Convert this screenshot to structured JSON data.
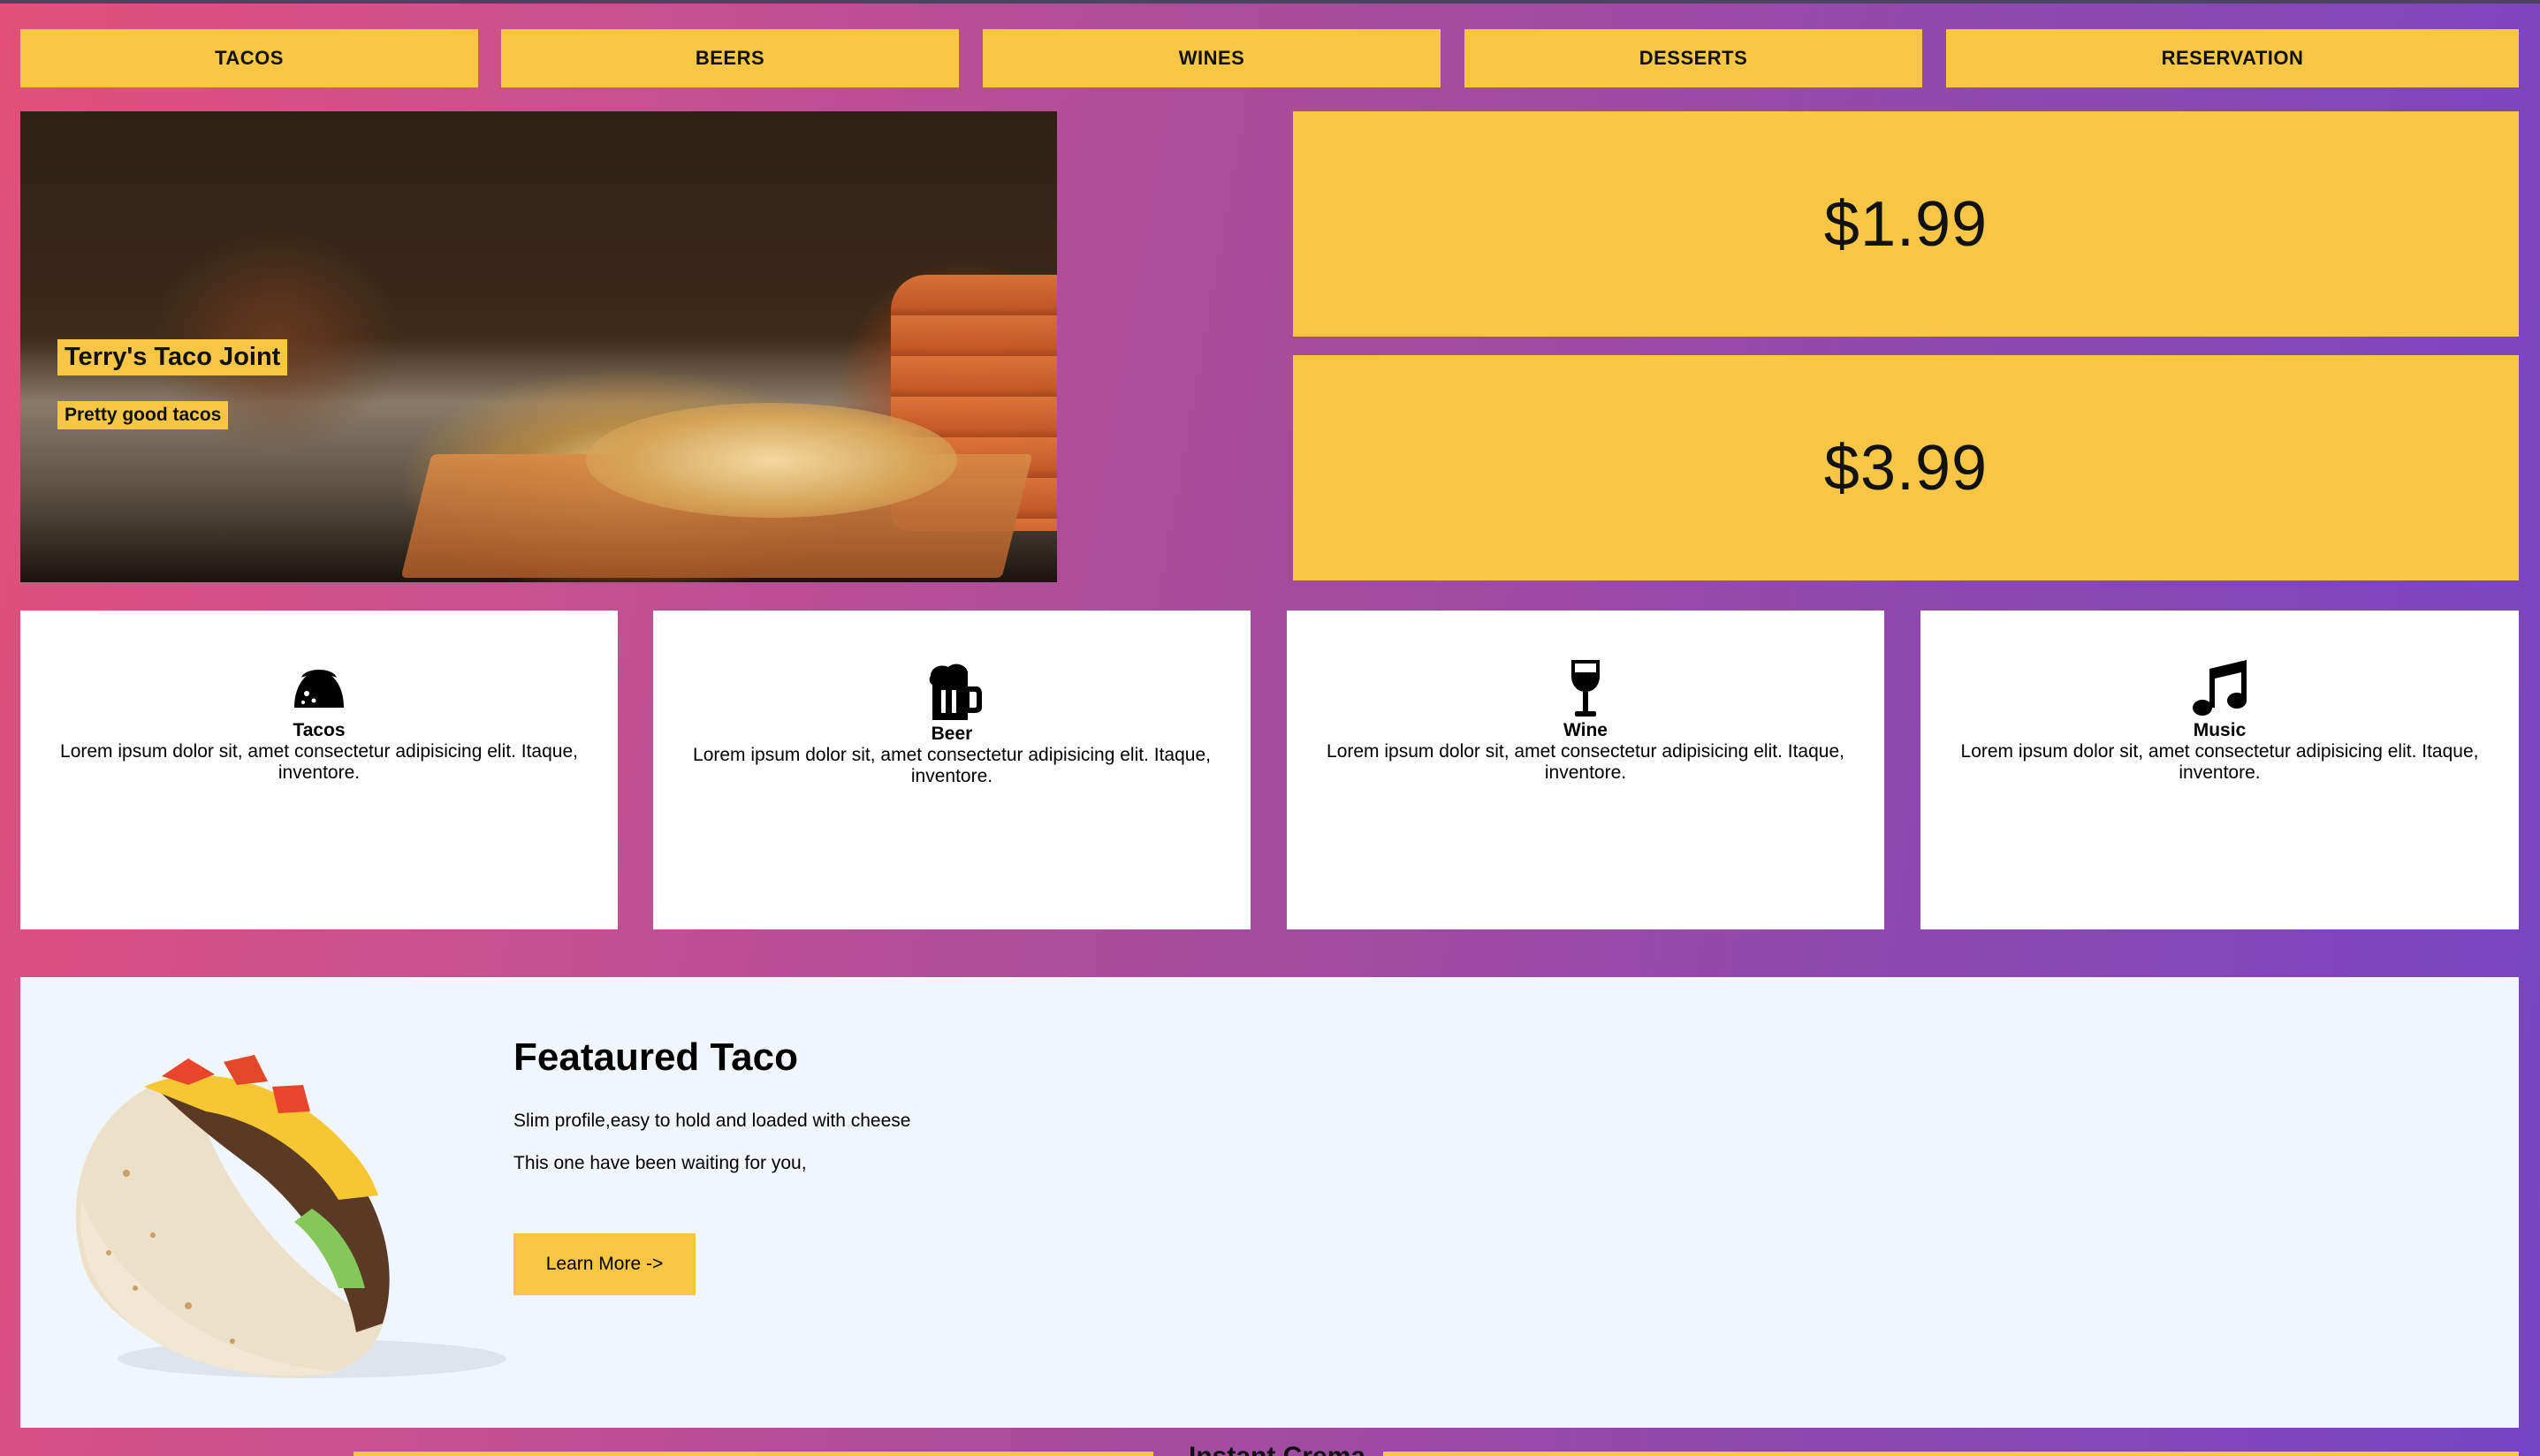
{
  "nav": {
    "items": [
      "TACOS",
      "BEERS",
      "WINES",
      "DESSERTS",
      "RESERVATION"
    ]
  },
  "hero": {
    "title": "Terry's Taco Joint",
    "subtitle": "Pretty good tacos"
  },
  "prices": [
    "$1.99",
    "$3.99"
  ],
  "features": [
    {
      "icon": "taco-icon",
      "title": "Tacos",
      "text": "Lorem ipsum dolor sit, amet consectetur adipisicing elit. Itaque, inventore."
    },
    {
      "icon": "beer-mug-icon",
      "title": "Beer",
      "text": "Lorem ipsum dolor sit, amet consectetur adipisicing elit. Itaque, inventore."
    },
    {
      "icon": "wine-glass-icon",
      "title": "Wine",
      "text": "Lorem ipsum dolor sit, amet consectetur adipisicing elit. Itaque, inventore."
    },
    {
      "icon": "music-note-icon",
      "title": "Music",
      "text": "Lorem ipsum dolor sit, amet consectetur adipisicing elit. Itaque, inventore."
    }
  ],
  "featured": {
    "title": "Feataured Taco",
    "line1": "Slim profile,easy to hold and loaded with cheese",
    "line2": "This one have been waiting for you,",
    "button": "Learn More ->"
  },
  "bottom": {
    "label": "Instant Crema"
  },
  "colors": {
    "accent": "#f6c644",
    "featured_bg": "#f0f6fc",
    "card_bg": "#ffffff"
  }
}
